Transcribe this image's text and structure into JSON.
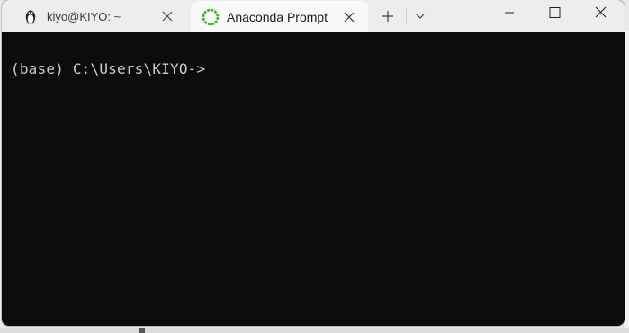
{
  "tabs": [
    {
      "title": "kiyo@KIYO: ~",
      "icon": "linux-penguin-icon",
      "active": false
    },
    {
      "title": "Anaconda Prompt",
      "icon": "anaconda-icon",
      "active": true
    }
  ],
  "toolbar": {
    "new_tab_icon": "plus-icon",
    "dropdown_icon": "chevron-down-icon"
  },
  "window_controls": {
    "minimize_icon": "minimize-icon",
    "maximize_icon": "maximize-icon",
    "close_icon": "close-icon"
  },
  "terminal": {
    "prompt": "(base) C:\\Users\\KIYO->"
  },
  "colors": {
    "terminal_bg": "#0c0c0c",
    "terminal_fg": "#cccccc",
    "titlebar_bg": "#ededed",
    "active_tab_bg": "#f9f9f9",
    "anaconda_green": "#43b02a"
  }
}
